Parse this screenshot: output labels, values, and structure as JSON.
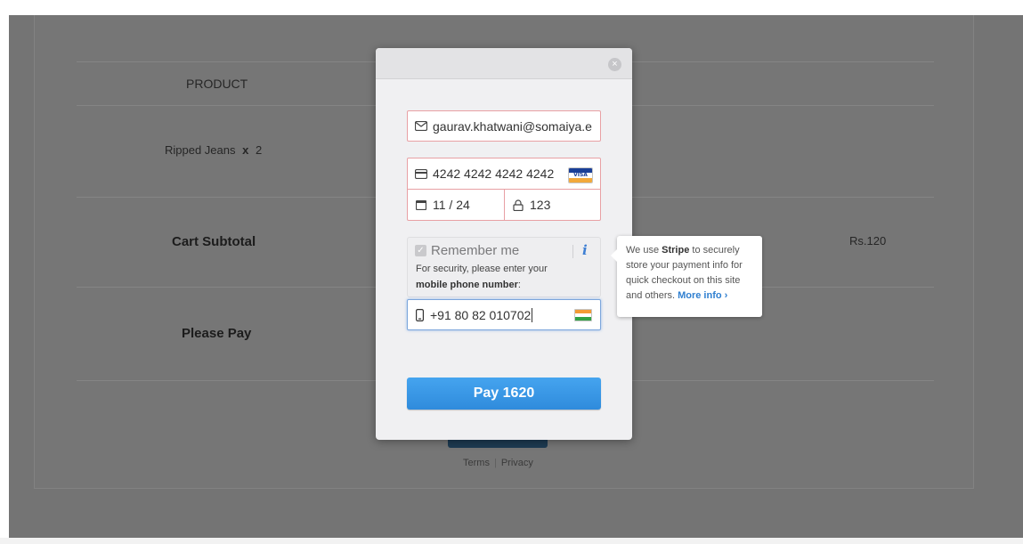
{
  "cart": {
    "header_product": "PRODUCT",
    "item_name": "Ripped Jeans",
    "item_x": "x",
    "item_qty": "2",
    "subtotal_label": "Cart Subtotal",
    "subtotal_value": "Rs.120",
    "please_pay_label": "Please Pay"
  },
  "footer": {
    "terms": "Terms",
    "separator": "|",
    "privacy": "Privacy"
  },
  "modal": {
    "close_glyph": "×",
    "email_value": "gaurav.khatwani@somaiya.e",
    "card_number": "4242 4242 4242 4242",
    "card_brand_text": "VISA",
    "expiry": "11 / 24",
    "cvc": "123",
    "remember_label": "Remember me",
    "info_glyph": "i",
    "security_line1": "For security, please enter your",
    "security_bold": "mobile phone number",
    "security_end": ":",
    "phone_value": "+91 80 82 010702",
    "pay_label": "Pay 1620"
  },
  "tooltip": {
    "pre": "We use ",
    "brand": "Stripe",
    "post": " to securely store your payment info for quick checkout on this site and others. ",
    "more": "More info ›"
  },
  "colors": {
    "pay_button": "#3d9ae8",
    "error_border": "#e8a0a4",
    "focus_border": "#7ca6dc",
    "overlay": "#747474"
  }
}
